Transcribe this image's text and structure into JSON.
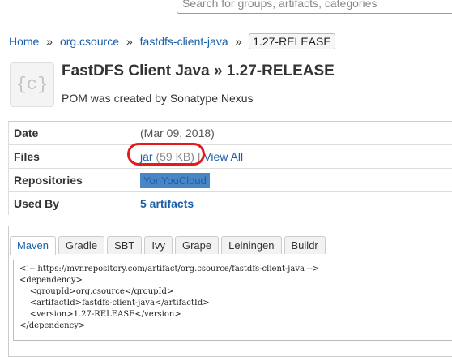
{
  "search": {
    "placeholder": "Search for groups, artifacts, categories"
  },
  "breadcrumb": {
    "home": "Home",
    "group": "org.csource",
    "artifact": "fastdfs-client-java",
    "version": "1.27-RELEASE",
    "separator": "»"
  },
  "header": {
    "logo_text": "{c}",
    "title": "FastDFS Client Java » 1.27-RELEASE",
    "subtitle": "POM was created by Sonatype Nexus"
  },
  "info": {
    "date_label": "Date",
    "date_value": "(Mar 09, 2018)",
    "files_label": "Files",
    "files_jar": "jar",
    "files_size": "(59 KB)",
    "files_view_all": "View All",
    "repos_label": "Repositories",
    "repos_value": "YonYouCloud",
    "usedby_label": "Used By",
    "usedby_value": "5 artifacts"
  },
  "tabs": [
    "Maven",
    "Gradle",
    "SBT",
    "Ivy",
    "Grape",
    "Leiningen",
    "Buildr"
  ],
  "active_tab": "Maven",
  "code": "<!-- https://mvnrepository.com/artifact/org.csource/fastdfs-client-java -->\n<dependency>\n    <groupId>org.csource</groupId>\n    <artifactId>fastdfs-client-java</artifactId>\n    <version>1.27-RELEASE</version>\n</dependency>",
  "colors": {
    "link": "#1a5fa8",
    "repo_badge": "#4a86c5",
    "annotation_circle": "#e41a1c"
  }
}
